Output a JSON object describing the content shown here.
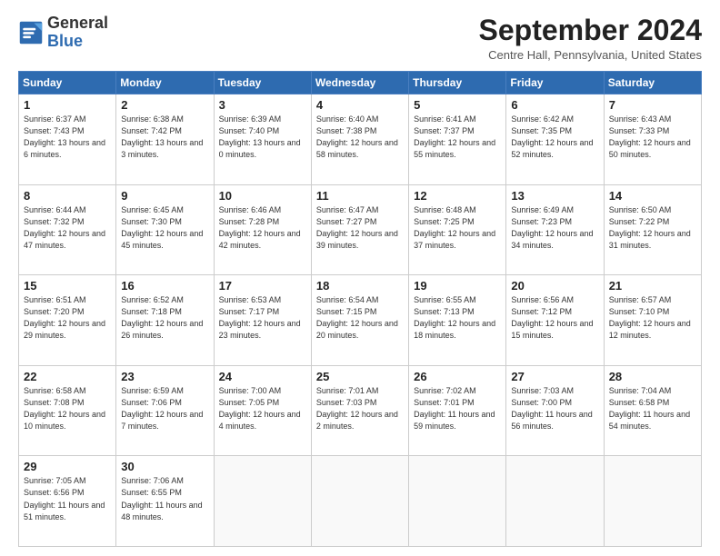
{
  "logo": {
    "line1": "General",
    "line2": "Blue"
  },
  "title": "September 2024",
  "location": "Centre Hall, Pennsylvania, United States",
  "days_of_week": [
    "Sunday",
    "Monday",
    "Tuesday",
    "Wednesday",
    "Thursday",
    "Friday",
    "Saturday"
  ],
  "weeks": [
    [
      {
        "day": 1,
        "sunrise": "6:37 AM",
        "sunset": "7:43 PM",
        "daylight": "13 hours and 6 minutes."
      },
      {
        "day": 2,
        "sunrise": "6:38 AM",
        "sunset": "7:42 PM",
        "daylight": "13 hours and 3 minutes."
      },
      {
        "day": 3,
        "sunrise": "6:39 AM",
        "sunset": "7:40 PM",
        "daylight": "13 hours and 0 minutes."
      },
      {
        "day": 4,
        "sunrise": "6:40 AM",
        "sunset": "7:38 PM",
        "daylight": "12 hours and 58 minutes."
      },
      {
        "day": 5,
        "sunrise": "6:41 AM",
        "sunset": "7:37 PM",
        "daylight": "12 hours and 55 minutes."
      },
      {
        "day": 6,
        "sunrise": "6:42 AM",
        "sunset": "7:35 PM",
        "daylight": "12 hours and 52 minutes."
      },
      {
        "day": 7,
        "sunrise": "6:43 AM",
        "sunset": "7:33 PM",
        "daylight": "12 hours and 50 minutes."
      }
    ],
    [
      {
        "day": 8,
        "sunrise": "6:44 AM",
        "sunset": "7:32 PM",
        "daylight": "12 hours and 47 minutes."
      },
      {
        "day": 9,
        "sunrise": "6:45 AM",
        "sunset": "7:30 PM",
        "daylight": "12 hours and 45 minutes."
      },
      {
        "day": 10,
        "sunrise": "6:46 AM",
        "sunset": "7:28 PM",
        "daylight": "12 hours and 42 minutes."
      },
      {
        "day": 11,
        "sunrise": "6:47 AM",
        "sunset": "7:27 PM",
        "daylight": "12 hours and 39 minutes."
      },
      {
        "day": 12,
        "sunrise": "6:48 AM",
        "sunset": "7:25 PM",
        "daylight": "12 hours and 37 minutes."
      },
      {
        "day": 13,
        "sunrise": "6:49 AM",
        "sunset": "7:23 PM",
        "daylight": "12 hours and 34 minutes."
      },
      {
        "day": 14,
        "sunrise": "6:50 AM",
        "sunset": "7:22 PM",
        "daylight": "12 hours and 31 minutes."
      }
    ],
    [
      {
        "day": 15,
        "sunrise": "6:51 AM",
        "sunset": "7:20 PM",
        "daylight": "12 hours and 29 minutes."
      },
      {
        "day": 16,
        "sunrise": "6:52 AM",
        "sunset": "7:18 PM",
        "daylight": "12 hours and 26 minutes."
      },
      {
        "day": 17,
        "sunrise": "6:53 AM",
        "sunset": "7:17 PM",
        "daylight": "12 hours and 23 minutes."
      },
      {
        "day": 18,
        "sunrise": "6:54 AM",
        "sunset": "7:15 PM",
        "daylight": "12 hours and 20 minutes."
      },
      {
        "day": 19,
        "sunrise": "6:55 AM",
        "sunset": "7:13 PM",
        "daylight": "12 hours and 18 minutes."
      },
      {
        "day": 20,
        "sunrise": "6:56 AM",
        "sunset": "7:12 PM",
        "daylight": "12 hours and 15 minutes."
      },
      {
        "day": 21,
        "sunrise": "6:57 AM",
        "sunset": "7:10 PM",
        "daylight": "12 hours and 12 minutes."
      }
    ],
    [
      {
        "day": 22,
        "sunrise": "6:58 AM",
        "sunset": "7:08 PM",
        "daylight": "12 hours and 10 minutes."
      },
      {
        "day": 23,
        "sunrise": "6:59 AM",
        "sunset": "7:06 PM",
        "daylight": "12 hours and 7 minutes."
      },
      {
        "day": 24,
        "sunrise": "7:00 AM",
        "sunset": "7:05 PM",
        "daylight": "12 hours and 4 minutes."
      },
      {
        "day": 25,
        "sunrise": "7:01 AM",
        "sunset": "7:03 PM",
        "daylight": "12 hours and 2 minutes."
      },
      {
        "day": 26,
        "sunrise": "7:02 AM",
        "sunset": "7:01 PM",
        "daylight": "11 hours and 59 minutes."
      },
      {
        "day": 27,
        "sunrise": "7:03 AM",
        "sunset": "7:00 PM",
        "daylight": "11 hours and 56 minutes."
      },
      {
        "day": 28,
        "sunrise": "7:04 AM",
        "sunset": "6:58 PM",
        "daylight": "11 hours and 54 minutes."
      }
    ],
    [
      {
        "day": 29,
        "sunrise": "7:05 AM",
        "sunset": "6:56 PM",
        "daylight": "11 hours and 51 minutes."
      },
      {
        "day": 30,
        "sunrise": "7:06 AM",
        "sunset": "6:55 PM",
        "daylight": "11 hours and 48 minutes."
      },
      null,
      null,
      null,
      null,
      null
    ]
  ]
}
